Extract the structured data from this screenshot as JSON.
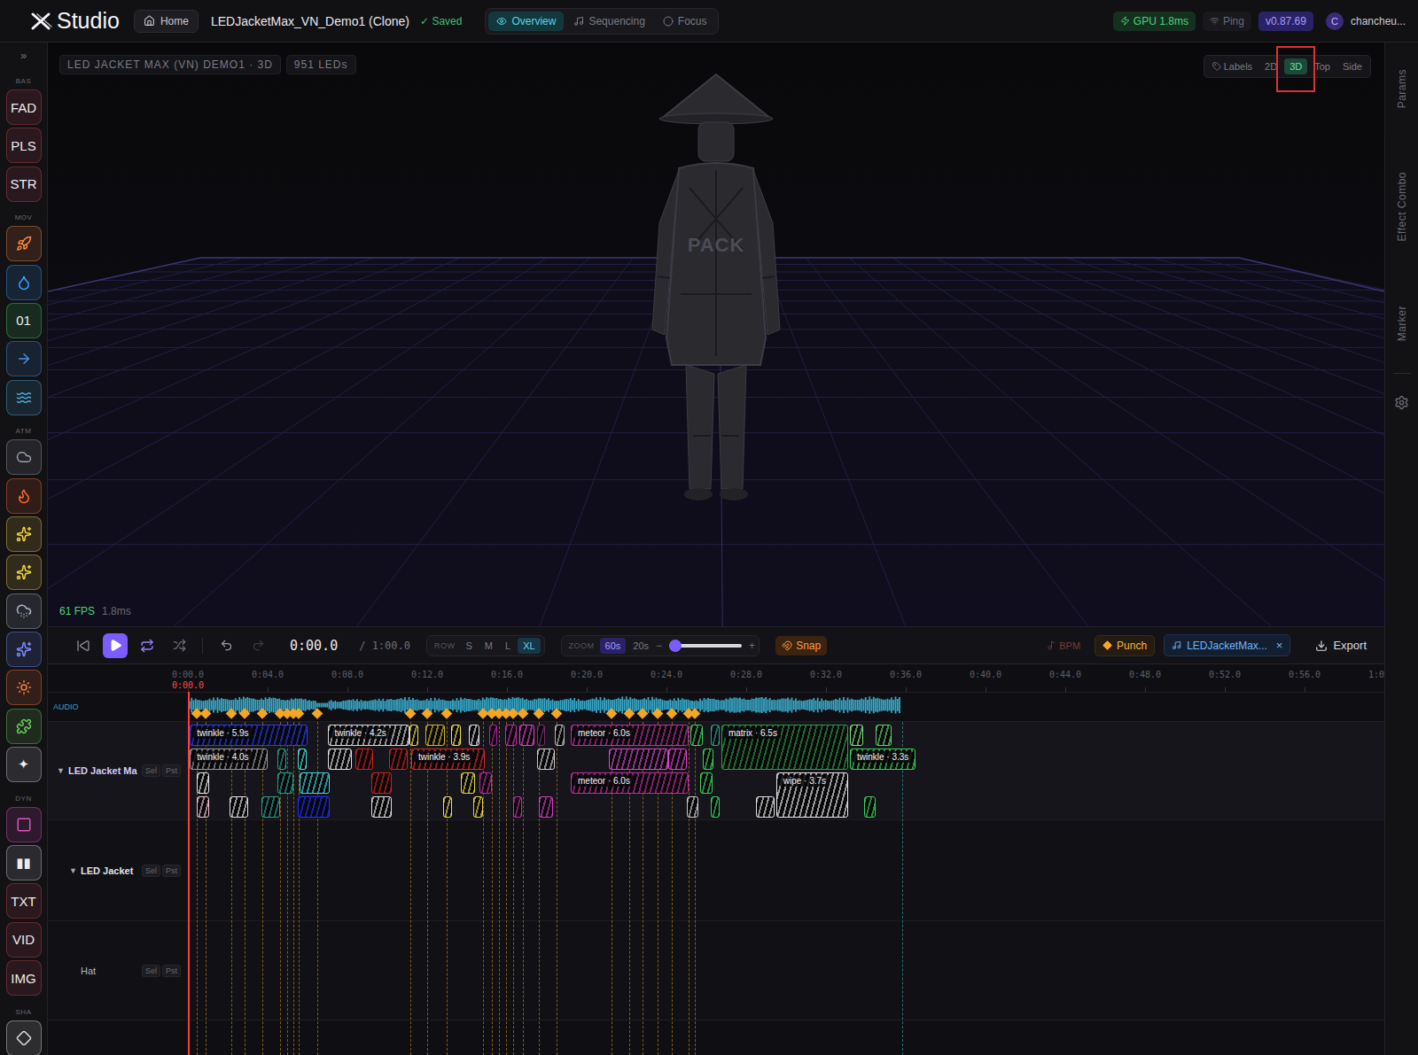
{
  "app": {
    "logo": "Studio"
  },
  "topbar": {
    "home": "Home",
    "project": "LEDJacketMax_VN_Demo1 (Clone)",
    "saved": "✓ Saved",
    "tabs": [
      {
        "label": "Overview",
        "selected": true
      },
      {
        "label": "Sequencing",
        "selected": false
      },
      {
        "label": "Focus",
        "selected": false
      }
    ],
    "gpu": "GPU 1.8ms",
    "ping": "Ping",
    "version": "v0.87.69",
    "avatar": "C",
    "user": "chancheu..."
  },
  "sidebar": {
    "toggle": "»",
    "sections": [
      {
        "label": "BAS",
        "items": [
          {
            "kind": "text",
            "label": "FAD",
            "color": "#c0404f"
          },
          {
            "kind": "text",
            "label": "PLS",
            "color": "#c0404f"
          },
          {
            "kind": "text",
            "label": "STR",
            "color": "#c0404f"
          }
        ]
      },
      {
        "label": "MOV",
        "items": [
          {
            "kind": "icon",
            "color": "#ff8a3c"
          },
          {
            "kind": "icon",
            "color": "#3aa0ff"
          },
          {
            "kind": "text",
            "label": "01",
            "color": "#3bd16f"
          },
          {
            "kind": "icon",
            "color": "#4a90e2"
          },
          {
            "kind": "icon",
            "color": "#4ab0e0"
          }
        ]
      },
      {
        "label": "ATM",
        "items": [
          {
            "kind": "icon",
            "color": "#9aa0b0"
          },
          {
            "kind": "icon",
            "color": "#ff6a2a"
          },
          {
            "kind": "icon",
            "color": "#f5d442"
          },
          {
            "kind": "icon",
            "color": "#f5d442"
          },
          {
            "kind": "icon",
            "color": "#b0b8c8"
          },
          {
            "kind": "icon",
            "color": "#7a8cff"
          },
          {
            "kind": "icon",
            "color": "#ff7a3c"
          },
          {
            "kind": "icon",
            "color": "#6fd05a"
          },
          {
            "kind": "text",
            "label": "✦",
            "color": "#d0d0e0"
          }
        ]
      },
      {
        "label": "DYN",
        "items": [
          {
            "kind": "icon",
            "color": "#e050c0"
          },
          {
            "kind": "text",
            "label": "▮▮",
            "color": "#d0d0d8"
          },
          {
            "kind": "text",
            "label": "TXT",
            "color": "#c0404f"
          },
          {
            "kind": "text",
            "label": "VID",
            "color": "#c0404f"
          },
          {
            "kind": "text",
            "label": "IMG",
            "color": "#c0404f"
          }
        ]
      },
      {
        "label": "SHA",
        "items": [
          {
            "kind": "icon",
            "color": "#e0e0e0"
          }
        ]
      }
    ]
  },
  "viewport": {
    "title": "LED JACKET MAX (VN) DEMO1 · 3D",
    "led_count": "951 LEDs",
    "views": [
      {
        "label": "Labels",
        "selected": false,
        "highlighted": false
      },
      {
        "label": "2D",
        "selected": false,
        "highlighted": false
      },
      {
        "label": "3D",
        "selected": true,
        "highlighted": true
      },
      {
        "label": "Top",
        "selected": false,
        "highlighted": false
      },
      {
        "label": "Side",
        "selected": false,
        "highlighted": false
      }
    ],
    "figure_label": "PACK",
    "fps": "61 FPS",
    "frame_time": "1.8ms"
  },
  "transport": {
    "time": "0:00.0",
    "duration": "/ 1:00.0",
    "loop_on": true,
    "shuffle_on": false,
    "undo_disabled": false,
    "redo_disabled": true,
    "row_label": "ROW",
    "rows": [
      {
        "label": "S",
        "selected": false
      },
      {
        "label": "M",
        "selected": false
      },
      {
        "label": "L",
        "selected": false
      },
      {
        "label": "XL",
        "selected": true
      }
    ],
    "zoom_label": "ZOOM",
    "zooms": [
      {
        "label": "60s",
        "selected": true
      },
      {
        "label": "20s",
        "selected": false
      }
    ],
    "zoom_minus": "−",
    "zoom_plus": "+",
    "zoom_level": 0.08,
    "snap": {
      "label": "Snap",
      "on": true
    },
    "bpm": {
      "label": "BPM",
      "on": false
    },
    "punch": "Punch",
    "audio_file": "LEDJacketMax...",
    "close": "×",
    "export": "Export"
  },
  "timeline": {
    "ruler": [
      "0:00.0",
      "0:04.0",
      "0:08.0",
      "0:12.0",
      "0:16.0",
      "0:20.0",
      "0:24.0",
      "0:28.0",
      "0:32.0",
      "0:36.0",
      "0:40.0",
      "0:44.0",
      "0:48.0",
      "0:52.0",
      "0:56.0",
      "1:0"
    ],
    "playhead": "0:00.0",
    "audio_label": "AUDIO",
    "markers": [
      0.45,
      0.9,
      2.17,
      2.85,
      3.75,
      4.61,
      4.97,
      5.29,
      5.56,
      6.5,
      11.16,
      12.02,
      12.97,
      14.78,
      15.23,
      15.59,
      15.95,
      16.31,
      16.81,
      17.58,
      18.48,
      21.24,
      22.14,
      22.82,
      23.54,
      24.27,
      25.12,
      25.44
    ],
    "tracks": [
      {
        "name": "LED Jacket Ma",
        "arrow": "▼",
        "kind": "group",
        "active": true,
        "sel": "Sel",
        "pst": "Pst",
        "clips": [
          {
            "label": "twinkle · 5.9s",
            "start": 0.1,
            "dur": 5.9,
            "lane": 0,
            "span": 1,
            "color": "#2b3cf0"
          },
          {
            "label": "twinkle · 4.2s",
            "start": 7.0,
            "dur": 4.1,
            "lane": 0,
            "span": 1,
            "color": "#d8d8d8"
          },
          {
            "start": 11.1,
            "dur": 0.45,
            "lane": 0,
            "span": 1,
            "color": "#e5d84a"
          },
          {
            "start": 11.9,
            "dur": 1.0,
            "lane": 0,
            "span": 1,
            "color": "#c9b52a"
          },
          {
            "start": 13.2,
            "dur": 0.5,
            "lane": 0,
            "span": 1,
            "color": "#f2e24b"
          },
          {
            "start": 14.1,
            "dur": 0.5,
            "lane": 0,
            "span": 1,
            "color": "#e0e0e0"
          },
          {
            "start": 15.1,
            "dur": 0.4,
            "lane": 0,
            "span": 1,
            "color": "#b3209b"
          },
          {
            "start": 15.9,
            "dur": 0.6,
            "lane": 0,
            "span": 1,
            "color": "#c42aa8"
          },
          {
            "start": 16.6,
            "dur": 0.8,
            "lane": 0,
            "span": 1,
            "color": "#e040c8"
          },
          {
            "start": 17.5,
            "dur": 0.4,
            "lane": 0,
            "span": 1,
            "color": "#7a2a6a"
          },
          {
            "start": 18.4,
            "dur": 0.5,
            "lane": 0,
            "span": 1,
            "color": "#bbbbbb"
          },
          {
            "label": "meteor · 6.0s",
            "start": 19.2,
            "dur": 5.9,
            "lane": 0,
            "span": 1,
            "color": "#c0309c"
          },
          {
            "start": 25.2,
            "dur": 0.6,
            "lane": 0,
            "span": 1,
            "color": "#3bd15a"
          },
          {
            "start": 26.2,
            "dur": 0.45,
            "lane": 0,
            "span": 1,
            "color": "#2aa08a"
          },
          {
            "label": "matrix · 6.5s",
            "start": 26.75,
            "dur": 6.35,
            "lane": 0,
            "span": 2,
            "color": "#2e9a46"
          },
          {
            "start": 33.2,
            "dur": 0.65,
            "lane": 0,
            "span": 1,
            "color": "#7fe07f"
          },
          {
            "start": 34.5,
            "dur": 0.8,
            "lane": 0,
            "span": 1,
            "color": "#5fd06a"
          },
          {
            "label": "twinkle · 4.0s",
            "start": 0.1,
            "dur": 3.9,
            "lane": 1,
            "span": 1,
            "color": "#9a9a9a"
          },
          {
            "start": 4.5,
            "dur": 0.45,
            "lane": 1,
            "span": 1,
            "color": "#2aa08a"
          },
          {
            "start": 5.5,
            "dur": 0.45,
            "lane": 1,
            "span": 1,
            "color": "#4fe0e0"
          },
          {
            "start": 7.0,
            "dur": 1.2,
            "lane": 1,
            "span": 1,
            "color": "#e0e0e0"
          },
          {
            "start": 8.4,
            "dur": 0.9,
            "lane": 1,
            "span": 1,
            "color": "#d02020"
          },
          {
            "start": 10.1,
            "dur": 0.9,
            "lane": 1,
            "span": 1,
            "color": "#d02020"
          },
          {
            "label": "twinkle · 3.9s",
            "start": 11.2,
            "dur": 3.7,
            "lane": 1,
            "span": 1,
            "color": "#d82a2a"
          },
          {
            "start": 17.5,
            "dur": 0.9,
            "lane": 1,
            "span": 1,
            "color": "#cccccc"
          },
          {
            "start": 21.1,
            "dur": 3.0,
            "lane": 1,
            "span": 1,
            "color": "#d848c8"
          },
          {
            "start": 24.1,
            "dur": 0.9,
            "lane": 1,
            "span": 1,
            "color": "#e040c8"
          },
          {
            "start": 25.8,
            "dur": 0.55,
            "lane": 1,
            "span": 1,
            "color": "#3bd15a"
          },
          {
            "label": "twinkle · 3.3s",
            "start": 33.2,
            "dur": 3.3,
            "lane": 1,
            "span": 1,
            "color": "#3bd15a"
          },
          {
            "start": 0.45,
            "dur": 0.6,
            "lane": 2,
            "span": 1,
            "color": "#e8e8e8"
          },
          {
            "start": 4.5,
            "dur": 0.8,
            "lane": 2,
            "span": 1,
            "color": "#2aa08a"
          },
          {
            "start": 5.6,
            "dur": 1.5,
            "lane": 2,
            "span": 1,
            "color": "#40d8e0"
          },
          {
            "start": 9.2,
            "dur": 1.0,
            "lane": 2,
            "span": 1,
            "color": "#d02020"
          },
          {
            "start": 13.7,
            "dur": 0.7,
            "lane": 2,
            "span": 1,
            "color": "#e5d84a"
          },
          {
            "start": 14.6,
            "dur": 0.65,
            "lane": 2,
            "span": 1,
            "color": "#c42aa8"
          },
          {
            "label": "meteor · 6.0s",
            "start": 19.2,
            "dur": 5.9,
            "lane": 2,
            "span": 1,
            "color": "#c0309c"
          },
          {
            "start": 25.7,
            "dur": 0.6,
            "lane": 2,
            "span": 1,
            "color": "#3bd15a"
          },
          {
            "label": "wipe · 3.7s",
            "start": 29.5,
            "dur": 3.6,
            "lane": 2,
            "span": 2,
            "color": "#e8e8e8"
          },
          {
            "start": 0.45,
            "dur": 0.6,
            "lane": 3,
            "span": 1,
            "color": "#f0c0d0"
          },
          {
            "start": 2.1,
            "dur": 0.9,
            "lane": 3,
            "span": 1,
            "color": "#e0e0e0"
          },
          {
            "start": 3.7,
            "dur": 0.9,
            "lane": 3,
            "span": 1,
            "color": "#2aa08a"
          },
          {
            "start": 5.5,
            "dur": 1.6,
            "lane": 3,
            "span": 1,
            "color": "#2030ff"
          },
          {
            "start": 9.2,
            "dur": 1.0,
            "lane": 3,
            "span": 1,
            "color": "#e0e0e0"
          },
          {
            "start": 12.8,
            "dur": 0.45,
            "lane": 3,
            "span": 1,
            "color": "#f2e24b"
          },
          {
            "start": 14.3,
            "dur": 0.5,
            "lane": 3,
            "span": 1,
            "color": "#e5d84a"
          },
          {
            "start": 16.3,
            "dur": 0.45,
            "lane": 3,
            "span": 1,
            "color": "#c42aa8"
          },
          {
            "start": 17.6,
            "dur": 0.7,
            "lane": 3,
            "span": 1,
            "color": "#d040c0"
          },
          {
            "start": 25.0,
            "dur": 0.6,
            "lane": 3,
            "span": 1,
            "color": "#cccccc"
          },
          {
            "start": 26.2,
            "dur": 0.45,
            "lane": 3,
            "span": 1,
            "color": "#3bd15a"
          },
          {
            "start": 28.5,
            "dur": 0.9,
            "lane": 3,
            "span": 1,
            "color": "#e0e0e0"
          },
          {
            "start": 33.9,
            "dur": 0.6,
            "lane": 3,
            "span": 1,
            "color": "#3bd15a"
          }
        ]
      },
      {
        "name": "LED Jacket",
        "arrow": "▼",
        "kind": "group",
        "active": false,
        "sel": "Sel",
        "pst": "Pst",
        "clips": []
      },
      {
        "name": "Hat",
        "kind": "leaf",
        "active": false,
        "sel": "Sel",
        "pst": "Pst",
        "clips": []
      }
    ]
  },
  "right_rail": {
    "items": [
      "Params",
      "Effect Combo",
      "Marker"
    ]
  }
}
